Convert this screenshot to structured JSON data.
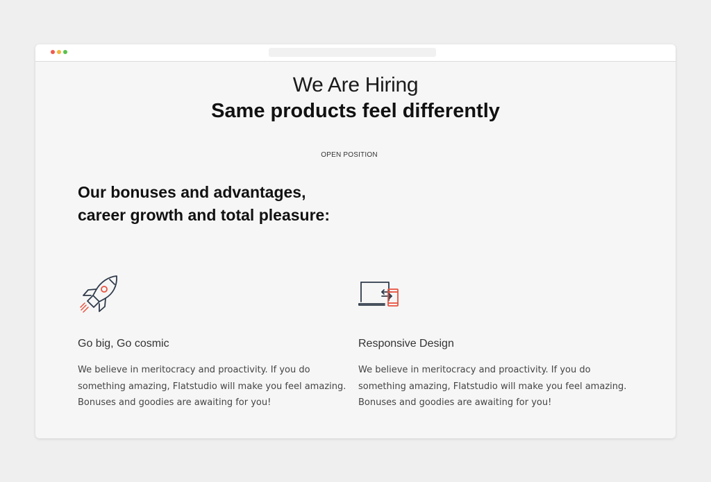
{
  "window": {
    "controls": [
      "close",
      "minimize",
      "maximize"
    ]
  },
  "header": {
    "title": "We Are Hiring",
    "tagline": "Same products feel differently",
    "open_position_link": "OPEN POSITION"
  },
  "intro": {
    "line1": "Our bonuses and advantages,",
    "line2": "career growth and total pleasure:"
  },
  "features": [
    {
      "icon": "rocket-icon",
      "title": "Go big, Go cosmic",
      "line1": "We believe in meritocracy and proactivity. If you do",
      "line2": "something amazing, Flatstudio will make you feel amazing.",
      "line3": "Bonuses and goodies are awaiting  for you!"
    },
    {
      "icon": "responsive-devices-icon",
      "title": "Responsive Design",
      "line1": "We believe in meritocracy and proactivity. If you do",
      "line2": "something amazing, Flatstudio will make you feel amazing.",
      "line3": "Bonuses and goodies are awaiting  for you!"
    }
  ],
  "colors": {
    "background": "#efefef",
    "window": "#f6f6f6",
    "icon_stroke": "#2f3a4a",
    "icon_accent": "#e8523f"
  }
}
